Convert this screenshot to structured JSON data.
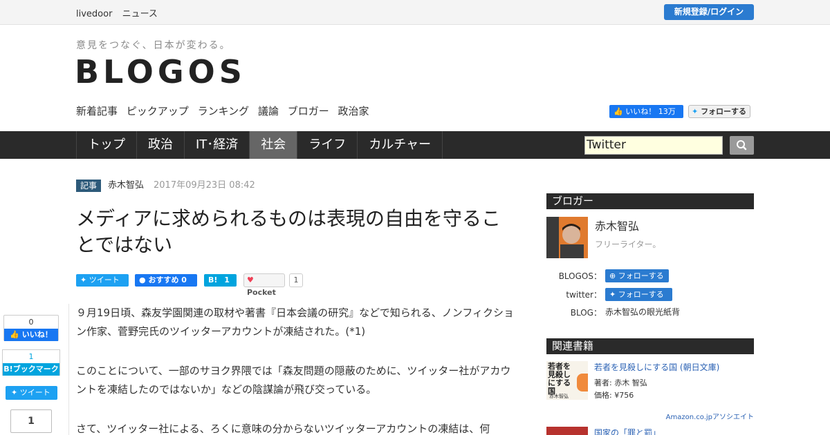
{
  "topbar": {
    "brand": "livedoor",
    "section": "ニュース",
    "login": "新規登録/ログイン"
  },
  "header": {
    "tagline": "意見をつなぐ、日本が変わる。",
    "logo": "BLOGOS",
    "subnav": [
      "新着記事",
      "ピックアップ",
      "ランキング",
      "議論",
      "ブロガー",
      "政治家"
    ],
    "fb_like": "いいね！ 13万",
    "tw_follow": "フォローする"
  },
  "mainnav": {
    "tabs": [
      "トップ",
      "政治",
      "IT･経済",
      "社会",
      "ライフ",
      "カルチャー"
    ],
    "active": "社会"
  },
  "search": {
    "value": "Twitter"
  },
  "article": {
    "category": "記事",
    "author": "赤木智弘",
    "date": "2017年09月23日 08:42",
    "title": "メディアに求められるものは表現の自由を守ることではない",
    "share": {
      "tweet": "ツイート",
      "fb": "おすすめ 0",
      "hatena": "1",
      "pocket": "Pocket",
      "pocket_count": "1"
    },
    "paragraphs": [
      "９月19日頃、森友学園関連の取材や著書『日本会議の研究』などで知られる、ノンフィクション作家、菅野完氏のツイッターアカウントが凍結された。(*1)",
      "このことについて、一部のサヨク界隈では「森友問題の隠蔽のために、ツイッター社がアカウントを凍結したのではないか」などの陰謀論が飛び交っている。",
      "さて、ツイッター社による、ろくに意味の分からないツイッターアカウントの凍結は、何"
    ]
  },
  "floating_share": {
    "fb_count": "0",
    "fb_label": "いいね！",
    "hb_count": "1",
    "hb_label": "ブックマーク",
    "tweet": "ツイート",
    "pocket_count": "1"
  },
  "sidebar": {
    "blogger_heading": "ブロガー",
    "blogger_name": "赤木智弘",
    "blogger_desc": "フリーライター。",
    "blogos_label": "BLOGOS：",
    "blogos_follow": "フォローする",
    "twitter_label": "twitter：",
    "twitter_follow": "フォローする",
    "blog_label": "BLOG：",
    "blog_name": "赤木智弘の眼光紙背",
    "books_heading": "関連書籍",
    "book1": {
      "cover_text": "若者を見殺しにする国",
      "cover_author": "赤木智弘",
      "title": "若者を見殺しにする国 (朝日文庫)",
      "author": "著者: 赤木 智弘",
      "price": "価格: ¥756"
    },
    "amazon_note": "Amazon.co.jpアソシエイト",
    "book2": {
      "title": "国家の「罪と罰」"
    }
  },
  "colors": {
    "accent_blue": "#2b7bd0",
    "nav_bg": "#2a2a2a",
    "twitter": "#1da1f2",
    "facebook": "#1877f2",
    "hatena": "#00a4de"
  }
}
